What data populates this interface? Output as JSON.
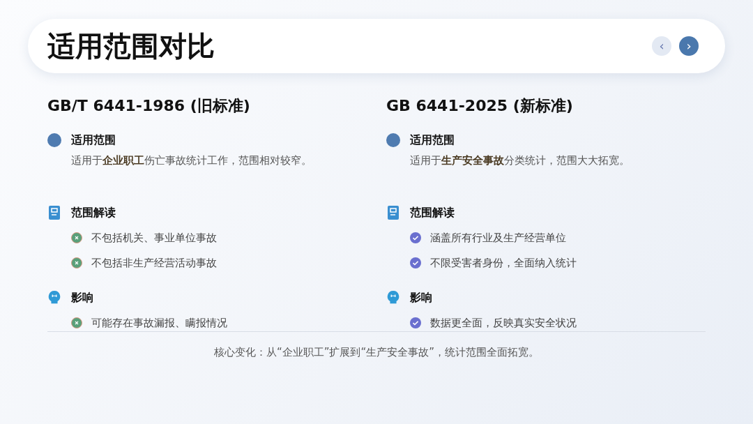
{
  "header": {
    "title": "适用范围对比",
    "nav": [
      {
        "label": "‹",
        "disabled": true
      },
      {
        "label": "›",
        "disabled": false
      }
    ]
  },
  "columns": [
    {
      "heading": "GB/T 6441-1986 (旧标准)",
      "sections": [
        {
          "kind": "dot",
          "title": "适用范围",
          "text": "适用于**企业职工**伤亡事故统计工作，范围相对较窄。"
        },
        {
          "kind": "doc",
          "title": "范围解读",
          "items": [
            {
              "kind": "cross",
              "text": "不包括机关、事业单位事故"
            },
            {
              "kind": "cross",
              "text": "不包括非生产经营活动事故"
            }
          ]
        },
        {
          "kind": "bulb",
          "title": "影响",
          "items": [
            {
              "kind": "cross",
              "text": "可能存在事故漏报、瞒报情况"
            }
          ]
        }
      ]
    },
    {
      "heading": "GB 6441-2025 (新标准)",
      "sections": [
        {
          "kind": "dot",
          "title": "适用范围",
          "text": "适用于**生产安全事故**分类统计，范围大大拓宽。"
        },
        {
          "kind": "doc",
          "title": "范围解读",
          "items": [
            {
              "kind": "check",
              "text": "涵盖所有行业及生产经营单位"
            },
            {
              "kind": "check",
              "text": "不限受害者身份，全面纳入统计"
            }
          ]
        },
        {
          "kind": "bulb",
          "title": "影响",
          "items": [
            {
              "kind": "check",
              "text": "数据更全面，反映真实安全状况"
            }
          ]
        }
      ]
    }
  ],
  "footer": "核心变化：从“企业职工”扩展到“生产安全事故”，统计范围全面拓宽。"
}
